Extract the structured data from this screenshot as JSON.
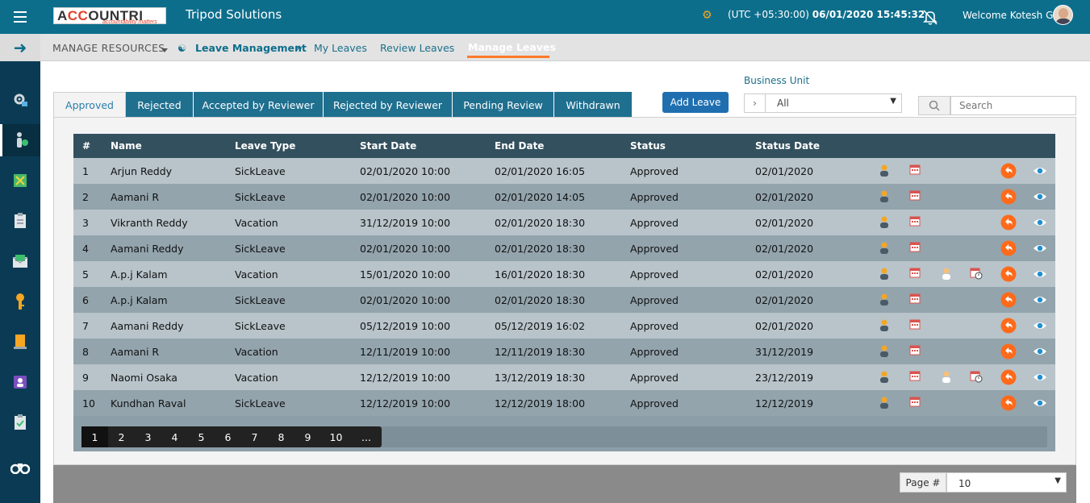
{
  "topbar": {
    "logo_text_a": "A",
    "logo_text_cc": "CC",
    "logo_text_rest": "OUNTRI",
    "logo_tagline": "accountability matters",
    "app_title": "Tripod Solutions",
    "tz": "(UTC +05:30:00)",
    "datetime": "06/01/2020 15:45:32",
    "welcome": "Welcome Kotesh G"
  },
  "subnav": {
    "manage_resources": "MANAGE RESOURCES",
    "leave_management": "Leave Management",
    "links": [
      "My Leaves",
      "Review Leaves",
      "Manage Leaves"
    ],
    "active_link": "Manage Leaves"
  },
  "tabs": [
    "Approved",
    "Rejected",
    "Accepted by Reviewer",
    "Rejected by Reviewer",
    "Pending Review",
    "Withdrawn"
  ],
  "active_tab": "Approved",
  "add_leave_label": "Add Leave",
  "business_unit": {
    "label": "Business Unit",
    "value": "All"
  },
  "search": {
    "placeholder": "Search"
  },
  "table": {
    "headers": [
      "#",
      "Name",
      "Leave Type",
      "Start Date",
      "End Date",
      "Status",
      "Status Date"
    ],
    "rows": [
      {
        "num": "1",
        "name": "Arjun Reddy",
        "type": "SickLeave",
        "start": "02/01/2020 10:00",
        "end": "02/01/2020 16:05",
        "status": "Approved",
        "status_date": "02/01/2020",
        "extra_icons": false
      },
      {
        "num": "2",
        "name": "Aamani R",
        "type": "SickLeave",
        "start": "02/01/2020 10:00",
        "end": "02/01/2020 14:05",
        "status": "Approved",
        "status_date": "02/01/2020",
        "extra_icons": false
      },
      {
        "num": "3",
        "name": "Vikranth Reddy",
        "type": "Vacation",
        "start": "31/12/2019 10:00",
        "end": "02/01/2020 18:30",
        "status": "Approved",
        "status_date": "02/01/2020",
        "extra_icons": false
      },
      {
        "num": "4",
        "name": "Aamani Reddy",
        "type": "SickLeave",
        "start": "02/01/2020 10:00",
        "end": "02/01/2020 18:30",
        "status": "Approved",
        "status_date": "02/01/2020",
        "extra_icons": false
      },
      {
        "num": "5",
        "name": "A.p.j Kalam",
        "type": "Vacation",
        "start": "15/01/2020 10:00",
        "end": "16/01/2020 18:30",
        "status": "Approved",
        "status_date": "02/01/2020",
        "extra_icons": true
      },
      {
        "num": "6",
        "name": "A.p.j Kalam",
        "type": "SickLeave",
        "start": "02/01/2020 10:00",
        "end": "02/01/2020 18:30",
        "status": "Approved",
        "status_date": "02/01/2020",
        "extra_icons": false
      },
      {
        "num": "7",
        "name": "Aamani Reddy",
        "type": "SickLeave",
        "start": "05/12/2019 10:00",
        "end": "05/12/2019 16:02",
        "status": "Approved",
        "status_date": "02/01/2020",
        "extra_icons": false
      },
      {
        "num": "8",
        "name": "Aamani R",
        "type": "Vacation",
        "start": "12/11/2019 10:00",
        "end": "12/11/2019 18:30",
        "status": "Approved",
        "status_date": "31/12/2019",
        "extra_icons": false
      },
      {
        "num": "9",
        "name": "Naomi Osaka",
        "type": "Vacation",
        "start": "12/12/2019 10:00",
        "end": "13/12/2019 18:30",
        "status": "Approved",
        "status_date": "23/12/2019",
        "extra_icons": true
      },
      {
        "num": "10",
        "name": "Kundhan Raval",
        "type": "SickLeave",
        "start": "12/12/2019 10:00",
        "end": "12/12/2019 18:00",
        "status": "Approved",
        "status_date": "12/12/2019",
        "extra_icons": false
      }
    ]
  },
  "pager": {
    "pages": [
      "1",
      "2",
      "3",
      "4",
      "5",
      "6",
      "7",
      "8",
      "9",
      "10",
      "..."
    ],
    "current": "1"
  },
  "page_size": {
    "label": "Page #",
    "value": "10"
  },
  "sidebar": {
    "items": [
      "settings-icon",
      "resource-money-icon",
      "puzzle-icon",
      "clipboard-icon",
      "mail-money-icon",
      "key-icon",
      "building-icon",
      "id-card-icon",
      "checklist-icon",
      "binoculars-icon"
    ]
  },
  "colors": {
    "topbar": "#0d6e8c",
    "sidebar": "#0b3b54",
    "accent": "#ff7a2a",
    "tab": "#1f6f8f"
  }
}
